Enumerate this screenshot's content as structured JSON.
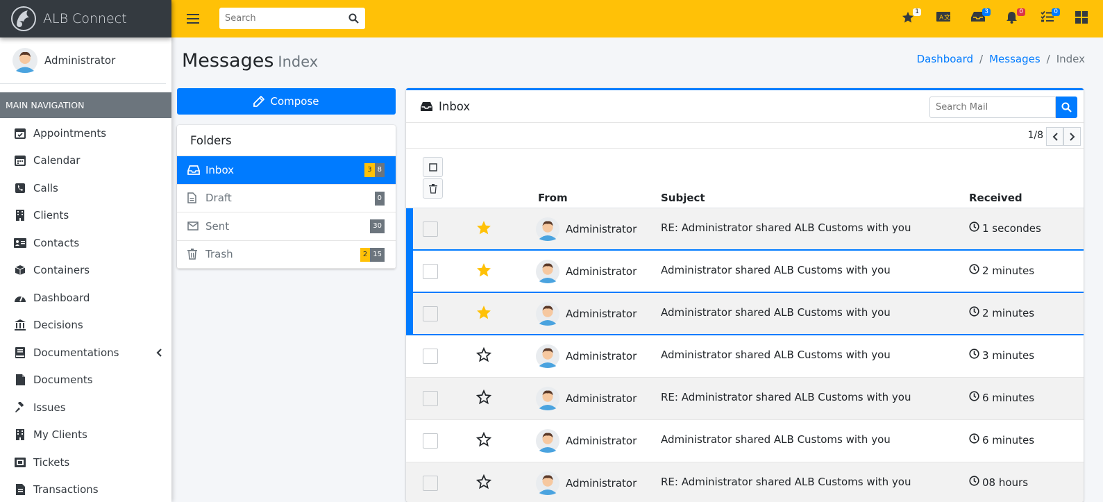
{
  "brand": {
    "name": "ALB Connect"
  },
  "user": {
    "name": "Administrator"
  },
  "sidebar": {
    "header": "MAIN NAVIGATION",
    "items": [
      {
        "label": "Appointments",
        "icon": "calendar-check-icon"
      },
      {
        "label": "Calendar",
        "icon": "calendar-icon"
      },
      {
        "label": "Calls",
        "icon": "phone-icon"
      },
      {
        "label": "Clients",
        "icon": "building-icon"
      },
      {
        "label": "Contacts",
        "icon": "address-card-icon"
      },
      {
        "label": "Containers",
        "icon": "cube-icon"
      },
      {
        "label": "Dashboard",
        "icon": "tachometer-icon"
      },
      {
        "label": "Decisions",
        "icon": "landmark-icon"
      },
      {
        "label": "Documentations",
        "icon": "book-icon"
      },
      {
        "label": "Documents",
        "icon": "file-icon"
      },
      {
        "label": "Issues",
        "icon": "gavel-icon"
      },
      {
        "label": "My Clients",
        "icon": "building-icon"
      },
      {
        "label": "Tickets",
        "icon": "ticket-icon"
      },
      {
        "label": "Transactions",
        "icon": "receipt-icon"
      }
    ]
  },
  "topbar": {
    "search_placeholder": "Search",
    "badges": {
      "favorites": "1",
      "inbox": "3",
      "notifications": "0",
      "tasks": "0"
    }
  },
  "page": {
    "title": "Messages",
    "subtitle": "Index"
  },
  "breadcrumb": {
    "item1": "Dashboard",
    "item2": "Messages",
    "item3": "Index"
  },
  "compose_label": "Compose",
  "folders": {
    "title": "Folders",
    "items": [
      {
        "label": "Inbox",
        "unread": "3",
        "total": "8"
      },
      {
        "label": "Draft",
        "total": "0"
      },
      {
        "label": "Sent",
        "total": "30"
      },
      {
        "label": "Trash",
        "unread": "2",
        "total": "15"
      }
    ]
  },
  "inbox": {
    "title": "Inbox",
    "search_placeholder": "Search Mail",
    "pager": "1/8",
    "columns": {
      "from": "From",
      "subject": "Subject",
      "received": "Received"
    },
    "rows": [
      {
        "from": "Administrator",
        "subject": "RE: Administrator shared ALB Customs with you",
        "received": "1 secondes",
        "starred": true
      },
      {
        "from": "Administrator",
        "subject": "Administrator shared ALB Customs with you",
        "received": "2 minutes",
        "starred": true
      },
      {
        "from": "Administrator",
        "subject": "Administrator shared ALB Customs with you",
        "received": "2 minutes",
        "starred": true
      },
      {
        "from": "Administrator",
        "subject": "Administrator shared ALB Customs with you",
        "received": "3 minutes",
        "starred": false
      },
      {
        "from": "Administrator",
        "subject": "RE: Administrator shared ALB Customs with you",
        "received": "6 minutes",
        "starred": false
      },
      {
        "from": "Administrator",
        "subject": "Administrator shared ALB Customs with you",
        "received": "6 minutes",
        "starred": false
      },
      {
        "from": "Administrator",
        "subject": "RE: Administrator shared ALB Customs with you",
        "received": "08 hours",
        "starred": false
      }
    ]
  },
  "colors": {
    "topbar": "#ffc107",
    "primary": "#007bff",
    "dark": "#343a40",
    "secondary": "#6c757d",
    "danger": "#dc3545"
  }
}
